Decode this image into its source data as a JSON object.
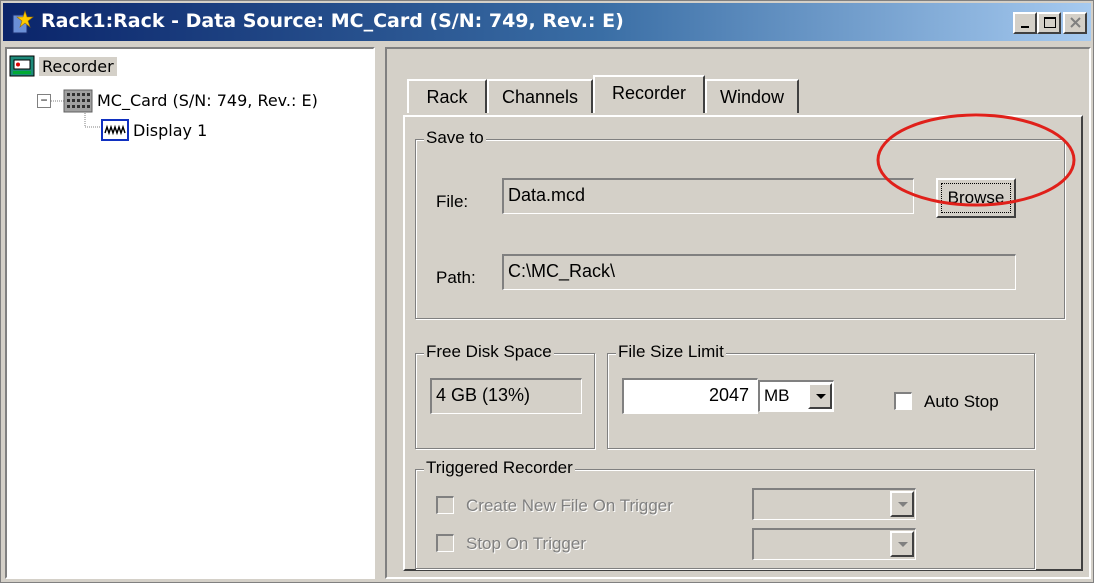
{
  "window": {
    "title": "Rack1:Rack - Data Source: MC_Card (S/N: 749, Rev.: E)"
  },
  "tree": {
    "items": [
      {
        "label": "Recorder",
        "icon": "recorder-icon"
      },
      {
        "label": "MC_Card (S/N: 749, Rev.: E)",
        "icon": "card-icon",
        "expander": "⊟"
      },
      {
        "label": "Display 1",
        "icon": "display-icon"
      }
    ]
  },
  "tabs": [
    {
      "label": "Rack",
      "active": false
    },
    {
      "label": "Channels",
      "active": false
    },
    {
      "label": "Recorder",
      "active": true
    },
    {
      "label": "Window",
      "active": false
    }
  ],
  "save_to": {
    "group_label": "Save to",
    "file_label": "File:",
    "file_value": "Data.mcd",
    "browse_label": "Browse",
    "path_label": "Path:",
    "path_value": "C:\\MC_Rack\\"
  },
  "free_disk": {
    "group_label": "Free Disk Space",
    "value": "4 GB  (13%)"
  },
  "file_size_limit": {
    "group_label": "File Size Limit",
    "value": "2047",
    "unit": "MB",
    "auto_stop_label": "Auto Stop",
    "auto_stop_checked": false
  },
  "triggered": {
    "group_label": "Triggered Recorder",
    "create_new_label": "Create New File On Trigger",
    "stop_label": "Stop On Trigger",
    "enabled": false
  },
  "annotation": {
    "color": "#e0201a",
    "target": "browse-button"
  }
}
